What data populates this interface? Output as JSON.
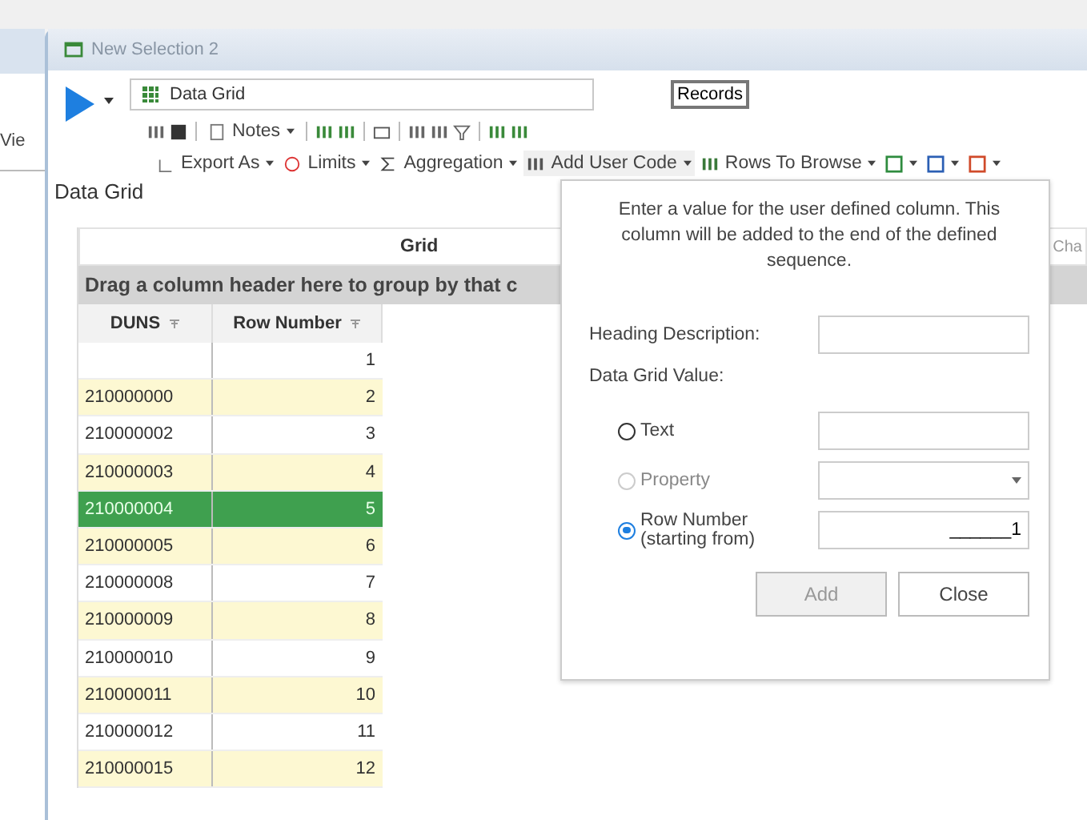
{
  "background": {
    "side_label": "Vie"
  },
  "window": {
    "title": "New Selection 2"
  },
  "query": {
    "name": "Data Grid",
    "records_button": "Records"
  },
  "toolbar_1": [
    {
      "kind": "icon"
    },
    {
      "kind": "icon"
    },
    {
      "kind": "sep"
    },
    {
      "kind": "menu",
      "label": "Notes"
    },
    {
      "kind": "sep"
    },
    {
      "kind": "icon"
    },
    {
      "kind": "icon"
    },
    {
      "kind": "sep"
    },
    {
      "kind": "icon"
    },
    {
      "kind": "sep"
    },
    {
      "kind": "icon"
    },
    {
      "kind": "icon"
    },
    {
      "kind": "icon"
    },
    {
      "kind": "sep"
    },
    {
      "kind": "icon"
    },
    {
      "kind": "icon"
    }
  ],
  "toolbar_2": [
    {
      "kind": "menu",
      "label": "Export As"
    },
    {
      "kind": "menu",
      "label": "Limits"
    },
    {
      "kind": "menu",
      "label": "Aggregation"
    },
    {
      "kind": "menu",
      "label": "Add User Code"
    },
    {
      "kind": "menu",
      "label": "Rows To Browse"
    },
    {
      "kind": "menu"
    },
    {
      "kind": "menu"
    },
    {
      "kind": "menu"
    }
  ],
  "section_title": "Data Grid",
  "grid": {
    "title": "Grid",
    "side_tab": "Cha",
    "group_hint": "Drag a column header here to group by that c",
    "columns": [
      "DUNS",
      "Row Number"
    ],
    "rows": [
      {
        "duns": "",
        "row_number": "1",
        "selected": false
      },
      {
        "duns": "210000000",
        "row_number": "2",
        "selected": false
      },
      {
        "duns": "210000002",
        "row_number": "3",
        "selected": false
      },
      {
        "duns": "210000003",
        "row_number": "4",
        "selected": false
      },
      {
        "duns": "210000004",
        "row_number": "5",
        "selected": true
      },
      {
        "duns": "210000005",
        "row_number": "6",
        "selected": false
      },
      {
        "duns": "210000008",
        "row_number": "7",
        "selected": false
      },
      {
        "duns": "210000009",
        "row_number": "8",
        "selected": false
      },
      {
        "duns": "210000010",
        "row_number": "9",
        "selected": false
      },
      {
        "duns": "210000011",
        "row_number": "10",
        "selected": false
      },
      {
        "duns": "210000012",
        "row_number": "11",
        "selected": false
      },
      {
        "duns": "210000015",
        "row_number": "12",
        "selected": false
      }
    ]
  },
  "popup": {
    "instructions": "Enter a value for the user defined column.  This column will be added to the end of the defined sequence.",
    "heading_label": "Heading Description:",
    "value_label": "Data Grid Value:",
    "options": [
      {
        "label": "Text",
        "kind": "text",
        "selected": false,
        "disabled": false
      },
      {
        "label": "Property",
        "kind": "dropdown",
        "selected": false,
        "disabled": true
      },
      {
        "label": "Row Number",
        "sublabel": "(starting  from)",
        "kind": "text",
        "value": "______1",
        "selected": true,
        "disabled": false
      }
    ],
    "buttons": [
      {
        "label": "Add",
        "disabled": true
      },
      {
        "label": "Close",
        "disabled": false
      }
    ]
  }
}
